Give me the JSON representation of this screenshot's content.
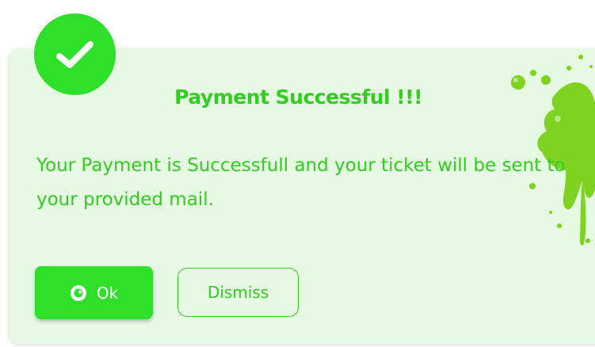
{
  "dialog": {
    "title": "Payment Successful !!!",
    "message": "Your Payment is Successfull and your ticket will be sent to your provided mail."
  },
  "buttons": {
    "ok_label": "Ok",
    "dismiss_label": "Dismiss"
  },
  "icons": {
    "badge": "check-icon",
    "ok": "eye-icon",
    "decoration": "paint-splash-decoration"
  },
  "colors": {
    "accent": "#2ee02a",
    "text": "#33cc20",
    "card_bg": "#e6fae3",
    "splash": "#7ed321"
  }
}
